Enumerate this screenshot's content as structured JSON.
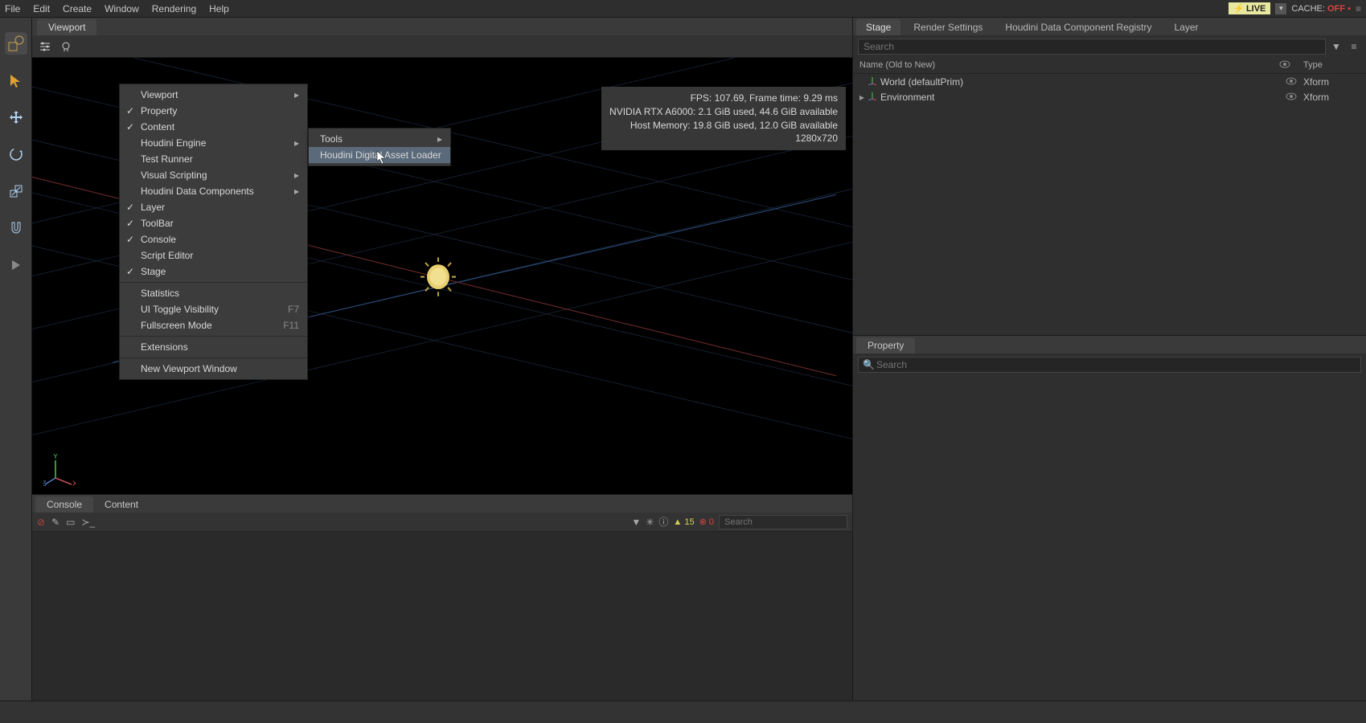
{
  "menubar": {
    "items": [
      "File",
      "Edit",
      "Create",
      "Window",
      "Rendering",
      "Help"
    ],
    "live_label": "LIVE",
    "cache_label": "CACHE:",
    "cache_value": "OFF"
  },
  "tabs": {
    "viewport": "Viewport"
  },
  "stats": {
    "line1": "FPS: 107.69, Frame time: 9.29 ms",
    "line2": "NVIDIA RTX A6000: 2.1 GiB used, 44.6 GiB available",
    "line3": "Host Memory: 19.8 GiB used, 12.0 GiB available",
    "line4": "1280x720"
  },
  "axis": {
    "x": "X",
    "y": "Y",
    "z": "Z"
  },
  "window_menu": {
    "items": [
      {
        "label": "Viewport",
        "submenu": true
      },
      {
        "label": "Property",
        "checked": true
      },
      {
        "label": "Content",
        "checked": true
      },
      {
        "label": "Houdini Engine",
        "submenu": true,
        "highlight": false
      },
      {
        "label": "Test Runner"
      },
      {
        "label": "Visual Scripting",
        "submenu": true
      },
      {
        "label": "Houdini Data Components",
        "submenu": true
      },
      {
        "label": "Layer",
        "checked": true
      },
      {
        "label": "ToolBar",
        "checked": true
      },
      {
        "label": "Console",
        "checked": true
      },
      {
        "label": "Script Editor"
      },
      {
        "label": "Stage",
        "checked": true
      }
    ],
    "lower": [
      {
        "label": "Statistics"
      },
      {
        "label": "UI Toggle Visibility",
        "shortcut": "F7"
      },
      {
        "label": "Fullscreen Mode",
        "shortcut": "F11"
      }
    ],
    "ext": [
      {
        "label": "Extensions"
      }
    ],
    "bottom": [
      {
        "label": "New Viewport Window"
      }
    ]
  },
  "submenu": {
    "items": [
      {
        "label": "Tools",
        "submenu": true
      },
      {
        "label": "Houdini Digital Asset Loader",
        "highlight": true
      }
    ]
  },
  "console": {
    "tabs": [
      "Console",
      "Content"
    ],
    "warn_count": "15",
    "err_count": "0",
    "search_placeholder": "Search"
  },
  "stage": {
    "tabs": [
      "Stage",
      "Render Settings",
      "Houdini Data Component Registry",
      "Layer"
    ],
    "search_placeholder": "Search",
    "header": {
      "name": "Name (Old to New)",
      "type": "Type"
    },
    "rows": [
      {
        "name": "World (defaultPrim)",
        "type": "Xform",
        "indent": 0,
        "expandable": false
      },
      {
        "name": "Environment",
        "type": "Xform",
        "indent": 0,
        "expandable": true
      }
    ]
  },
  "property": {
    "tab": "Property",
    "search_placeholder": "Search"
  }
}
